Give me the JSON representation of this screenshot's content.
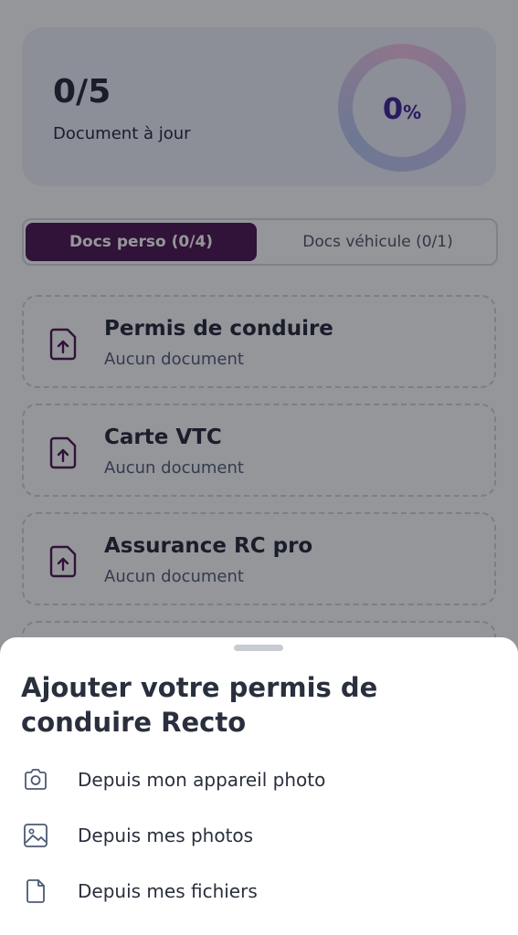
{
  "summary": {
    "count": "0/5",
    "label": "Document à jour",
    "percent_number": "0",
    "percent_sign": "%"
  },
  "tabs": [
    {
      "label": "Docs perso (0/4)",
      "active": true
    },
    {
      "label": "Docs véhicule (0/1)",
      "active": false
    }
  ],
  "documents": [
    {
      "title": "Permis de conduire",
      "status": "Aucun document"
    },
    {
      "title": "Carte VTC",
      "status": "Aucun document"
    },
    {
      "title": "Assurance RC pro",
      "status": "Aucun document"
    }
  ],
  "sheet": {
    "title": "Ajouter votre permis de conduire Recto",
    "options": [
      {
        "label": "Depuis mon appareil photo",
        "icon": "camera-icon"
      },
      {
        "label": "Depuis mes photos",
        "icon": "image-icon"
      },
      {
        "label": "Depuis mes fichiers",
        "icon": "file-icon"
      }
    ]
  },
  "colors": {
    "accent": "#4a0f4e",
    "percent": "#3b1f96"
  }
}
